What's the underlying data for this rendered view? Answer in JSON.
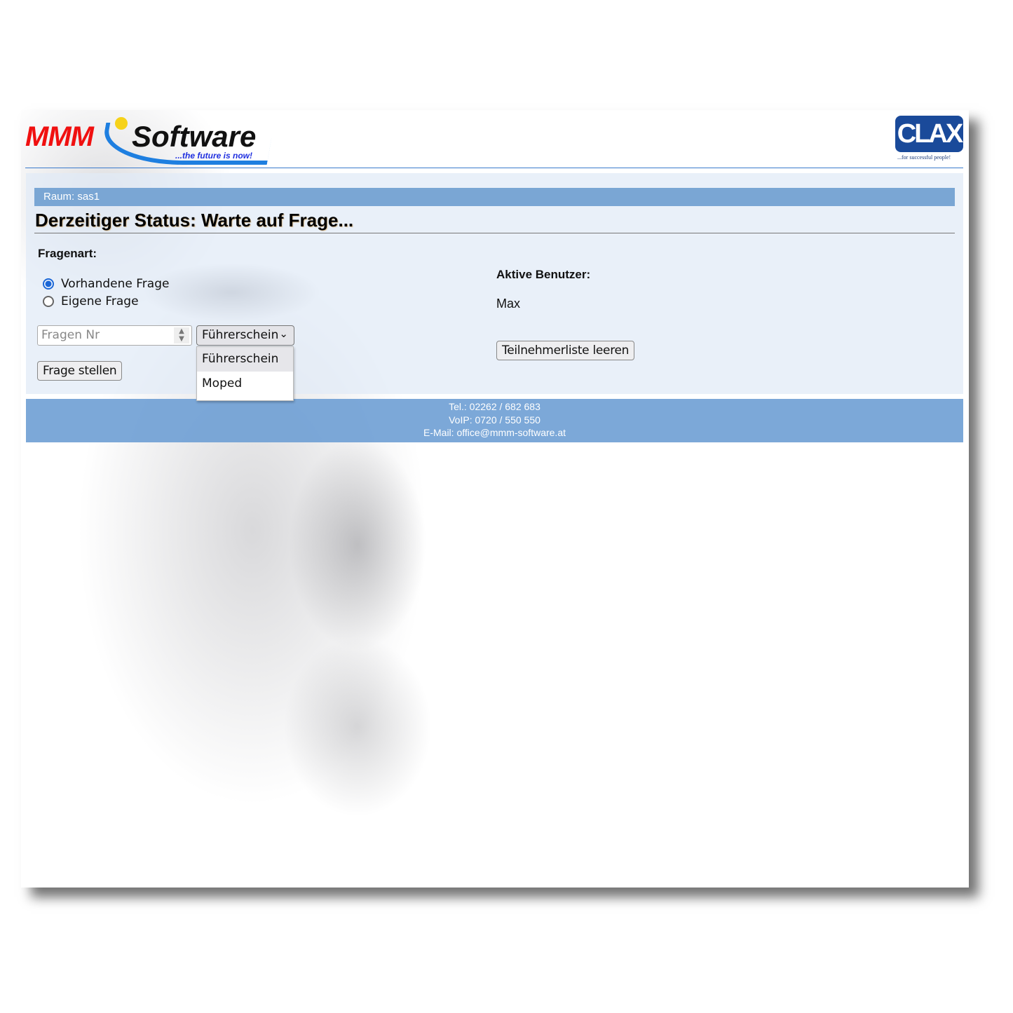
{
  "header": {
    "logo_brand": "MMM",
    "logo_name": "Software",
    "logo_tagline": "...the future is now!",
    "partner_logo": "CLAX",
    "partner_tagline": "...for successful people!"
  },
  "room": {
    "label": "Raum: sas1"
  },
  "status": {
    "title": "Derzeitiger Status: Warte auf Frage..."
  },
  "question": {
    "heading": "Fragenart:",
    "options": [
      {
        "label": "Vorhandene Frage",
        "selected": true
      },
      {
        "label": "Eigene Frage",
        "selected": false
      }
    ],
    "number_placeholder": "Fragen Nr",
    "category_selected": "Führerschein",
    "category_options": [
      "Führerschein",
      "Moped"
    ],
    "submit_label": "Frage stellen"
  },
  "users": {
    "heading": "Aktive Benutzer:",
    "list": [
      "Max"
    ],
    "clear_label": "Teilnehmerliste leeren"
  },
  "footer": {
    "tel": "Tel.: 02262 / 682 683",
    "voip": "VoIP: 0720 / 550 550",
    "email": "E-Mail: office@mmm-software.at"
  },
  "colors": {
    "bar": "#7aa6d4",
    "brand_red": "#f01010",
    "accent": "#1e7fe0"
  }
}
